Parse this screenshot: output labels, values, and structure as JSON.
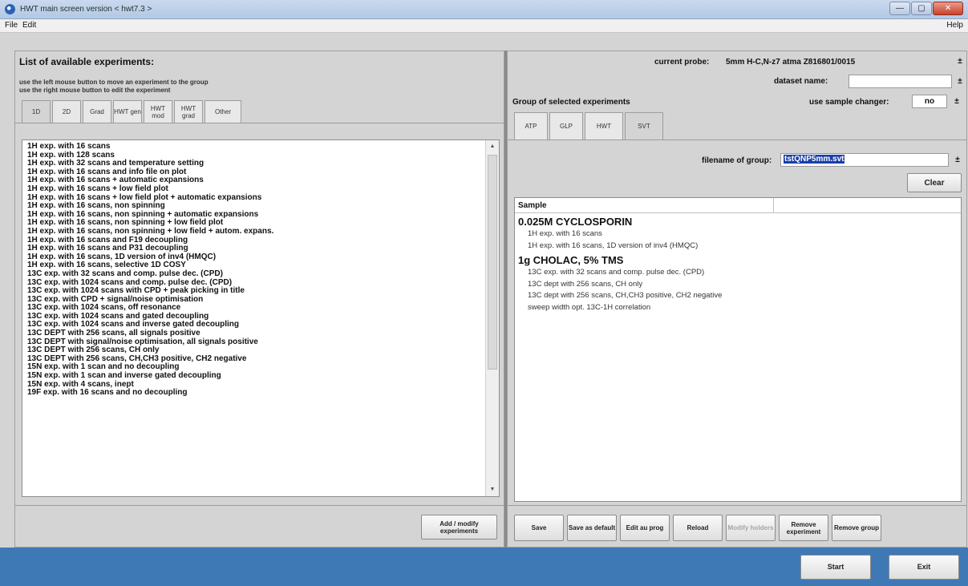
{
  "window": {
    "title": "HWT main screen   version < hwt7.3 >",
    "controls": [
      "—",
      "▢",
      "✕"
    ]
  },
  "menu": {
    "file": "File",
    "edit": "Edit",
    "help": "Help"
  },
  "left": {
    "heading": "List of available experiments:",
    "hint1": "use the left mouse button to move an experiment to the group",
    "hint2": "use the right mouse button to edit the experiment",
    "tabs": [
      "1D",
      "2D",
      "Grad",
      "HWT gen",
      "HWT mod",
      "HWT grad",
      "Other"
    ],
    "experiments": [
      "1H exp. with 16 scans",
      "1H exp. with 128 scans",
      "1H exp. with 32 scans and temperature setting",
      "1H exp. with 16 scans and info file on plot",
      "1H exp. with 16 scans + automatic expansions",
      "1H exp. with 16 scans + low field plot",
      "1H exp. with 16 scans + low field plot + automatic expansions",
      "1H exp. with 16 scans, non spinning",
      "1H exp. with 16 scans, non spinning + automatic expansions",
      "1H exp. with 16 scans, non spinning + low field plot",
      "1H exp. with 16 scans, non spinning + low field + autom. expans.",
      "1H exp. with 16 scans and F19 decoupling",
      "1H exp. with 16 scans and P31 decoupling",
      "1H exp. with 16 scans, 1D version of inv4 (HMQC)",
      "1H exp. with 16 scans, selective 1D COSY",
      "13C exp. with 32 scans and comp. pulse dec. (CPD)",
      "13C exp. with 1024 scans and comp. pulse dec. (CPD)",
      "13C exp. with 1024 scans with CPD + peak picking in title",
      "13C exp. with CPD + signal/noise optimisation",
      "13C exp. with 1024 scans, off resonance",
      "13C exp. with 1024 scans and gated decoupling",
      "13C exp. with 1024 scans and inverse gated decoupling",
      "13C DEPT with 256 scans, all signals positive",
      "13C DEPT with signal/noise optimisation, all signals positive",
      "13C DEPT with 256 scans, CH only",
      "13C DEPT with 256 scans, CH,CH3 positive, CH2 negative",
      "15N exp. with 1 scan and no decoupling",
      "15N exp. with 1 scan and inverse gated decoupling",
      "15N exp. with 4 scans, inept",
      "19F exp. with 16 scans and no decoupling"
    ],
    "add_button": "Add / modify experiments"
  },
  "right": {
    "probe_label": "current probe:",
    "probe_value": "5mm  H-C,N-z7 atma   Z816801/0015",
    "dataset_label": "dataset name:",
    "dataset_value": "",
    "group_heading": "Group of selected experiments",
    "sample_changer_label": "use sample changer:",
    "sample_changer_value": "no",
    "tabs": [
      "ATP",
      "GLP",
      "HWT",
      "SVT"
    ],
    "filename_label": "filename of group:",
    "filename_value": "tstQNP5mm.svt",
    "clear_button": "Clear",
    "table_header": "Sample",
    "groups": [
      {
        "title": "0.025M CYCLOSPORIN",
        "experiments": [
          "1H exp. with 16 scans",
          "1H exp. with 16 scans, 1D version of inv4 (HMQC)"
        ]
      },
      {
        "title": "1g CHOLAC, 5% TMS",
        "experiments": [
          "13C exp. with 32 scans and comp. pulse dec. (CPD)",
          "13C dept with 256 scans, CH only",
          "13C dept with 256 scans, CH,CH3 positive, CH2 negative",
          "sweep width opt. 13C-1H correlation"
        ]
      }
    ],
    "buttons": {
      "save": "Save",
      "save_default": "Save as default",
      "edit_prog": "Edit au prog",
      "reload": "Reload",
      "modify_holders": "Modify holders",
      "remove_experiment": "Remove experiment",
      "remove_group": "Remove group"
    }
  },
  "footer": {
    "start": "Start",
    "exit": "Exit"
  },
  "colors": {
    "footer_bg": "#3f79b5",
    "selection": "#1a3fa8"
  }
}
